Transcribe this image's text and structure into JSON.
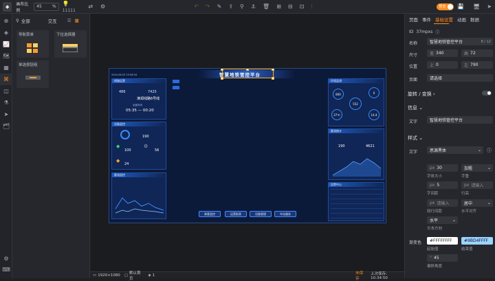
{
  "toolbar": {
    "zoom_label": "画布比例",
    "zoom_value": "45",
    "zoom_unit": "%",
    "count": "11111",
    "preview_toggle": "预览"
  },
  "components": {
    "all_label": "全部",
    "interact_label": "交互",
    "cards": [
      "导航菜单",
      "下拉选择器",
      "单选按钮组"
    ]
  },
  "screen": {
    "title": "智慧地铁管控平台",
    "datetime": "2024-06-03 15:58:34",
    "p1_title": "线路运营",
    "p1_count": "486",
    "p1_value": "7425",
    "p1_line": "津郑线路6号线",
    "p1_time_label": "运营时间",
    "p1_time": "05:35 — 00:20",
    "p2_title": "设备监控",
    "p2_v1": "190",
    "p2_v2": "100",
    "p2_v3": "56",
    "p2_v4": "24",
    "p3_title": "客流监控",
    "p4_title": "环境监测",
    "p4_v1": "800",
    "p4_v2": "0",
    "p4_v3": "552",
    "p4_v4": "27℃",
    "p4_v5": "14.4",
    "p5_title": "客流统计",
    "p5_v1": "190",
    "p5_v2": "4621",
    "p6_title": "告警中心",
    "nav_buttons": [
      "乘客监控",
      "运营报表",
      "设备管理",
      "车站服务"
    ]
  },
  "rightpanel": {
    "tabs": [
      "页面",
      "事件",
      "基础设置",
      "动画",
      "数据"
    ],
    "active_tab": "基础设置",
    "id_label": "ID",
    "id_value": "37mpxs",
    "name_label": "名称",
    "name_value": "智慧地铁管控平台",
    "name_count": "8 / 12",
    "size_label": "尺寸",
    "width_label": "宽",
    "width_value": "340",
    "height_label": "高",
    "height_value": "72",
    "pos_label": "位置",
    "top_label": "上",
    "top_value": "0",
    "left_label": "左",
    "left_value": "790",
    "page_label": "页面",
    "page_placeholder": "请选择",
    "transform_label": "旋转 / 变换",
    "info_label": "信息",
    "text_label": "文字",
    "text_value": "智慧地铁管控平台",
    "style_label": "样式",
    "font_label": "文字",
    "font_value": "思源黑体",
    "fontsize_value": "30",
    "fontsize_caption": "字体大小",
    "weight_value": "加粗",
    "weight_caption": "字重",
    "spacing_value": "5",
    "spacing_caption": "字间距",
    "lineheight_placeholder": "请输入",
    "lineheight_caption": "行高",
    "linespacing_placeholder": "请输入",
    "linespacing_caption": "段行间距",
    "align_value": "居中",
    "align_caption": "水平对齐",
    "direction_value": "水平",
    "direction_caption": "文本方向",
    "gradient_label": "渐变色",
    "start_color": "#FFFFFFFF",
    "start_caption": "起始值",
    "end_color": "#9BD4FFFF",
    "end_caption": "结束值",
    "angle_value": "45",
    "angle_caption": "偏移角度"
  },
  "statusbar": {
    "resolution": "1920×1080",
    "default_page": "默认首页",
    "layer_count": "1",
    "save_text": "未保存",
    "saved_time": "上次保存: 10:34:50"
  },
  "colors": {
    "accent": "#ff8a1f",
    "screen_bg": "#0c1a3a",
    "panel_bg": "#26272c"
  }
}
